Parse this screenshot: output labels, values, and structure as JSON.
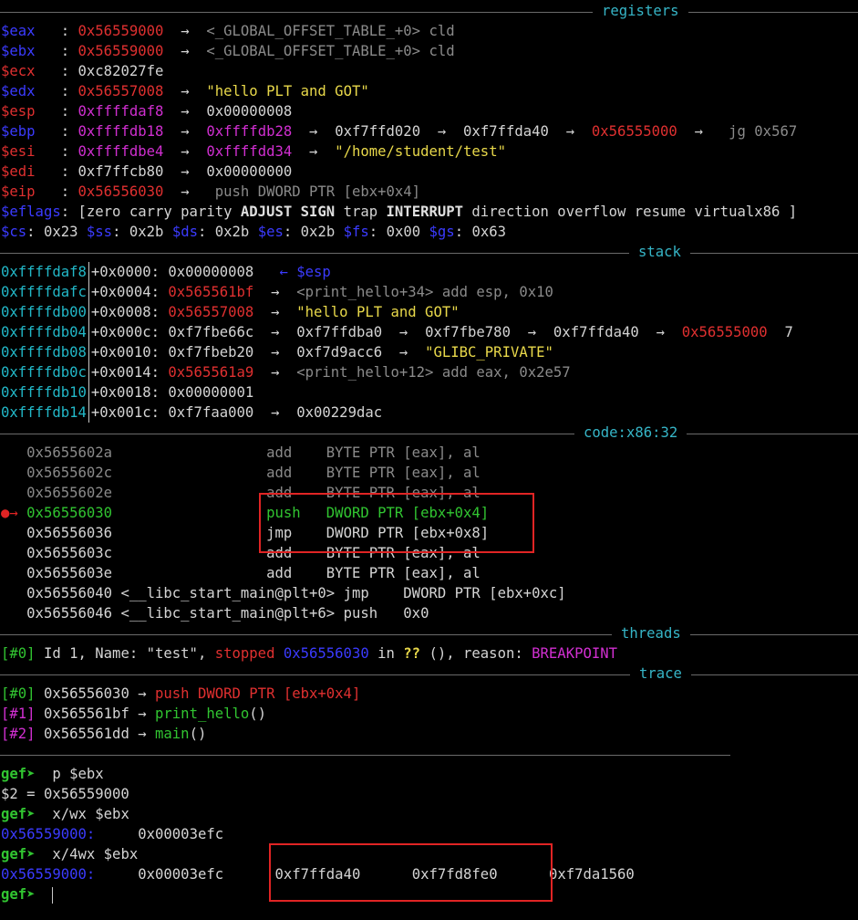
{
  "sections": {
    "registers": "registers",
    "stack": "stack",
    "code": "code:x86:32",
    "threads": "threads",
    "trace": "trace"
  },
  "registers": {
    "eax": {
      "name": "$eax",
      "value": "0x56559000",
      "deref": "<_GLOBAL_OFFSET_TABLE_+0> cld"
    },
    "ebx": {
      "name": "$ebx",
      "value": "0x56559000",
      "deref": "<_GLOBAL_OFFSET_TABLE_+0> cld"
    },
    "ecx": {
      "name": "$ecx",
      "value": "0xc82027fe"
    },
    "edx": {
      "name": "$edx",
      "value": "0x56557008",
      "deref": "\"hello PLT and GOT\""
    },
    "esp": {
      "name": "$esp",
      "value": "0xffffdaf8",
      "deref": "0x00000008"
    },
    "ebp": {
      "name": "$ebp",
      "value": "0xffffdb18",
      "d1": "0xffffdb28",
      "d2": "0xf7ffd020",
      "d3": "0xf7ffda40",
      "d4": "0x56555000",
      "d5": "jg 0x567"
    },
    "esi": {
      "name": "$esi",
      "value": "0xffffdbe4",
      "d1": "0xffffdd34",
      "d2": "\"/home/student/test\""
    },
    "edi": {
      "name": "$edi",
      "value": "0xf7ffcb80",
      "deref": "0x00000000"
    },
    "eip": {
      "name": "$eip",
      "value": "0x56556030",
      "deref": "push DWORD PTR [ebx+0x4]"
    },
    "eflags": {
      "name": "$eflags",
      "open": "[",
      "f1": "zero carry parity",
      "f2": "ADJUST",
      "f3": "SIGN",
      "f4": "trap",
      "f5": "INTERRUPT",
      "f6": "direction overflow resume virtualx86",
      "close": "]"
    },
    "segs": {
      "cs_n": "$cs",
      "cs_v": "0x23",
      "ss_n": "$ss",
      "ss_v": "0x2b",
      "ds_n": "$ds",
      "ds_v": "0x2b",
      "es_n": "$es",
      "es_v": "0x2b",
      "fs_n": "$fs",
      "fs_v": "0x00",
      "gs_n": "$gs",
      "gs_v": "0x63"
    }
  },
  "stack": [
    {
      "addr": "0xffffdaf8",
      "off": "+0x0000:",
      "v": "0x00000008",
      "esp": "← $esp"
    },
    {
      "addr": "0xffffdafc",
      "off": "+0x0004:",
      "v": "0x565561bf",
      "d1": "<print_hello+34> add esp, 0x10"
    },
    {
      "addr": "0xffffdb00",
      "off": "+0x0008:",
      "v": "0x56557008",
      "d1": "\"hello PLT and GOT\""
    },
    {
      "addr": "0xffffdb04",
      "off": "+0x000c:",
      "v": "0xf7fbe66c",
      "d1": "0xf7ffdba0",
      "d2": "0xf7fbe780",
      "d3": "0xf7ffda40",
      "d4": "0x56555000",
      "d5": "7"
    },
    {
      "addr": "0xffffdb08",
      "off": "+0x0010:",
      "v": "0xf7fbeb20",
      "d1": "0xf7d9acc6",
      "d2": "\"GLIBC_PRIVATE\""
    },
    {
      "addr": "0xffffdb0c",
      "off": "+0x0014:",
      "v": "0x565561a9",
      "d1": "<print_hello+12> add eax, 0x2e57"
    },
    {
      "addr": "0xffffdb10",
      "off": "+0x0018:",
      "v": "0x00000001"
    },
    {
      "addr": "0xffffdb14",
      "off": "+0x001c:",
      "v": "0xf7faa000",
      "d1": "0x00229dac"
    }
  ],
  "code": [
    {
      "addr": "0x5655602a",
      "mn": "add",
      "op": "BYTE PTR [eax], al"
    },
    {
      "addr": "0x5655602c",
      "mn": "add",
      "op": "BYTE PTR [eax], al"
    },
    {
      "addr": "0x5655602e",
      "mn": "add",
      "op": "BYTE PTR [eax], al"
    },
    {
      "addr": "0x56556030",
      "mn": "push",
      "op": "DWORD PTR [ebx+0x4]",
      "marker": "●→"
    },
    {
      "addr": "0x56556036",
      "mn": "jmp",
      "op": "DWORD PTR [ebx+0x8]"
    },
    {
      "addr": "0x5655603c",
      "mn": "add",
      "op": "BYTE PTR [eax], al"
    },
    {
      "addr": "0x5655603e",
      "mn": "add",
      "op": "BYTE PTR [eax], al"
    },
    {
      "addr": "0x56556040",
      "sym": "<__libc_start_main@plt+0>",
      "mn": "jmp",
      "op": "DWORD PTR [ebx+0xc]"
    },
    {
      "addr": "0x56556046",
      "sym": "<__libc_start_main@plt+6>",
      "mn": "push",
      "op": "0x0"
    }
  ],
  "threads": {
    "idx": "[#0]",
    "a": "Id 1, Name: \"test\",",
    "state": "stopped",
    "addr": "0x56556030",
    "b": "in",
    "q": "??",
    "c": "(), reason:",
    "reason": "BREAKPOINT"
  },
  "trace": [
    {
      "idx": "[#0]",
      "addr": "0x56556030",
      "fn": "push DWORD PTR [ebx+0x4]"
    },
    {
      "idx": "[#1]",
      "addr": "0x565561bf",
      "fn": "print_hello",
      "args": "()"
    },
    {
      "idx": "[#2]",
      "addr": "0x565561dd",
      "fn": "main",
      "args": "()"
    }
  ],
  "arrow": "→",
  "session": {
    "prompt": "gef➤",
    "cmd1": "p $ebx",
    "out1": "$2 = 0x56559000",
    "cmd2": "x/wx $ebx",
    "out2_addr": "0x56559000:",
    "out2_v": "0x00003efc",
    "cmd3": "x/4wx $ebx",
    "out3_addr": "0x56559000:",
    "out3_v1": "0x00003efc",
    "out3_v2": "0xf7ffda40",
    "out3_v3": "0xf7fd8fe0",
    "out3_v4": "0xf7da1560"
  }
}
